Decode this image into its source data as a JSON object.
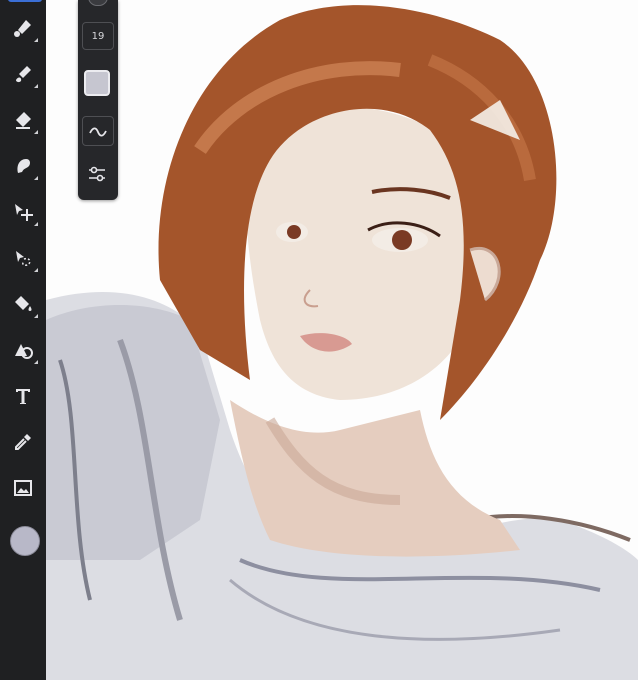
{
  "toolbar": {
    "tools": [
      {
        "name": "brush-icon"
      },
      {
        "name": "blend-brush-icon"
      },
      {
        "name": "eraser-icon"
      },
      {
        "name": "smudge-icon"
      },
      {
        "name": "move-transform-icon"
      },
      {
        "name": "lasso-select-icon"
      },
      {
        "name": "fill-bucket-icon"
      },
      {
        "name": "shape-icon"
      },
      {
        "name": "text-icon"
      },
      {
        "name": "eyedropper-icon"
      },
      {
        "name": "image-icon"
      }
    ],
    "active_color": "#b8b8c8",
    "accent_color": "#3b6fd6"
  },
  "brush_panel": {
    "size_value": "19",
    "opacity_color": "#c6c6d0",
    "smoothing_icon": "wave-icon",
    "settings_icon": "sliders-icon"
  }
}
